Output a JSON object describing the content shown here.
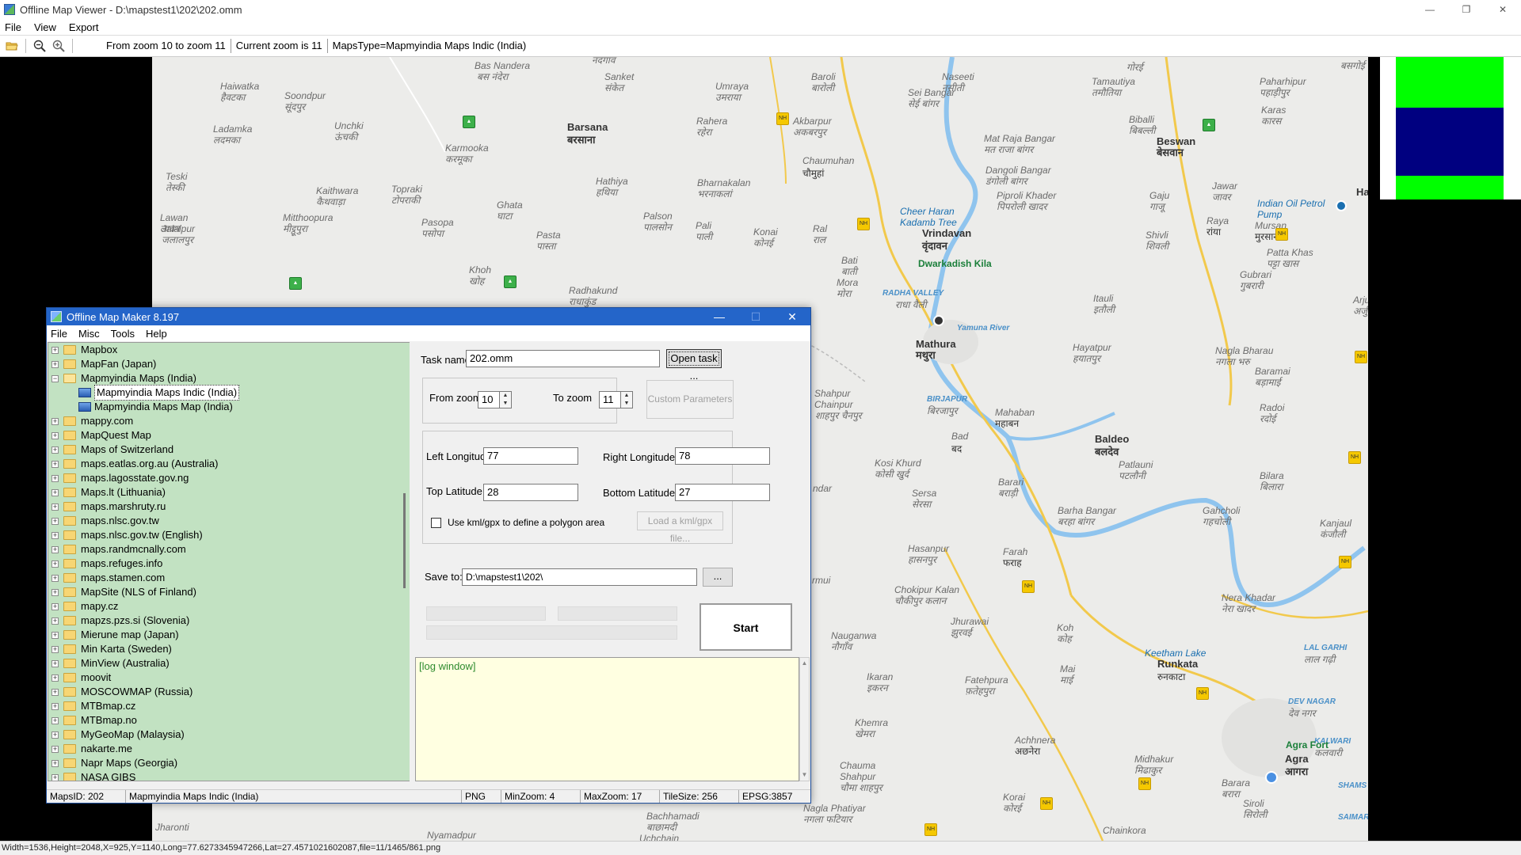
{
  "window": {
    "title": "Offline Map Viewer - D:\\mapstest1\\202\\202.omm",
    "controls": {
      "minimize": "—",
      "restore": "❐",
      "close": "✕"
    }
  },
  "menubar": [
    "File",
    "View",
    "Export"
  ],
  "toolbar": {
    "icons": [
      "open-folder-icon",
      "zoom-out-icon",
      "zoom-in-icon"
    ],
    "zoom_range": "From zoom 10 to zoom 11",
    "current_zoom": "Current zoom is 11",
    "maps_type": "MapsType=Mapmyindia Maps Indic (India)"
  },
  "map": {
    "labels": [
      {
        "text": "Bas Nandera",
        "cls": ""
      },
      {
        "text": "बस नंदेरा",
        "cls": ""
      },
      {
        "text": "नदगाव",
        "cls": ""
      },
      {
        "text": "Sanket",
        "cls": ""
      },
      {
        "text": "संकेत",
        "cls": ""
      },
      {
        "text": "Umraya",
        "cls": ""
      },
      {
        "text": "उमराया",
        "cls": ""
      },
      {
        "text": "Baroli",
        "cls": ""
      },
      {
        "text": "बारोली",
        "cls": ""
      },
      {
        "text": "Naseeti",
        "cls": ""
      },
      {
        "text": "नसीती",
        "cls": ""
      },
      {
        "text": "गोरई",
        "cls": ""
      },
      {
        "text": "बसगोई",
        "cls": ""
      },
      {
        "text": "Haiwatka",
        "cls": ""
      },
      {
        "text": "हैवटका",
        "cls": ""
      },
      {
        "text": "Soondpur",
        "cls": ""
      },
      {
        "text": "सूंदपुर",
        "cls": ""
      },
      {
        "text": "Barsana",
        "cls": "town"
      },
      {
        "text": "बरसाना",
        "cls": "town"
      },
      {
        "text": "Rahera",
        "cls": ""
      },
      {
        "text": "रहेरा",
        "cls": ""
      },
      {
        "text": "Akbarpur",
        "cls": ""
      },
      {
        "text": "अकबरपुर",
        "cls": ""
      },
      {
        "text": "Sei Bangar",
        "cls": ""
      },
      {
        "text": "सेई बांगर",
        "cls": ""
      },
      {
        "text": "Tamautiya",
        "cls": ""
      },
      {
        "text": "तमौतिया",
        "cls": ""
      },
      {
        "text": "Paharhipur",
        "cls": ""
      },
      {
        "text": "पहाड़ीपुर",
        "cls": ""
      },
      {
        "text": "Karas",
        "cls": ""
      },
      {
        "text": "कारस",
        "cls": ""
      },
      {
        "text": "Ladamka",
        "cls": ""
      },
      {
        "text": "लदमका",
        "cls": ""
      },
      {
        "text": "Unchki",
        "cls": ""
      },
      {
        "text": "ऊंचकी",
        "cls": ""
      },
      {
        "text": "Karmooka",
        "cls": ""
      },
      {
        "text": "करमूका",
        "cls": ""
      },
      {
        "text": "Mat Raja Bangar",
        "cls": ""
      },
      {
        "text": "मत राजा बांगर",
        "cls": ""
      },
      {
        "text": "Biballi",
        "cls": ""
      },
      {
        "text": "बिबल्ली",
        "cls": ""
      },
      {
        "text": "Beswan",
        "cls": "town"
      },
      {
        "text": "बेसवान",
        "cls": "town"
      },
      {
        "text": "Chaumuhan",
        "cls": ""
      },
      {
        "text": "चौमुहां",
        "cls": "dark"
      },
      {
        "text": "Dangoli Bangar",
        "cls": ""
      },
      {
        "text": "डंगोली बांगर",
        "cls": ""
      },
      {
        "text": "Teski",
        "cls": ""
      },
      {
        "text": "तेस्की",
        "cls": ""
      },
      {
        "text": "Kaithwara",
        "cls": ""
      },
      {
        "text": "कैथवाड़ा",
        "cls": ""
      },
      {
        "text": "Topraki",
        "cls": ""
      },
      {
        "text": "टोपराकी",
        "cls": ""
      },
      {
        "text": "Hathiya",
        "cls": ""
      },
      {
        "text": "हथिया",
        "cls": ""
      },
      {
        "text": "Bharnakalan",
        "cls": ""
      },
      {
        "text": "भरनाकलां",
        "cls": ""
      },
      {
        "text": "Piproli Khader",
        "cls": ""
      },
      {
        "text": "पिपरोली खादर",
        "cls": ""
      },
      {
        "text": "Gaju",
        "cls": ""
      },
      {
        "text": "गाजू",
        "cls": ""
      },
      {
        "text": "Jawar",
        "cls": ""
      },
      {
        "text": "जावर",
        "cls": ""
      },
      {
        "text": "Ghata",
        "cls": ""
      },
      {
        "text": "घाटा",
        "cls": ""
      },
      {
        "text": "Lawan",
        "cls": ""
      },
      {
        "text": "लावन",
        "cls": ""
      },
      {
        "text": "Mitthoopura",
        "cls": ""
      },
      {
        "text": "मीट्ठूपुरा",
        "cls": ""
      },
      {
        "text": "Pasopa",
        "cls": ""
      },
      {
        "text": "पसोपा",
        "cls": ""
      },
      {
        "text": "Palson",
        "cls": ""
      },
      {
        "text": "पालसोन",
        "cls": ""
      },
      {
        "text": "Cheer Haran",
        "cls": "poi"
      },
      {
        "text": "Kadamb Tree",
        "cls": "poi"
      },
      {
        "text": "Indian Oil Petrol",
        "cls": "poi"
      },
      {
        "text": "Pump",
        "cls": "poi"
      },
      {
        "text": "Pali",
        "cls": ""
      },
      {
        "text": "पाली",
        "cls": ""
      },
      {
        "text": "Vrindavan",
        "cls": "town"
      },
      {
        "text": "वृंदावन",
        "cls": "town"
      },
      {
        "text": "Mursan",
        "cls": ""
      },
      {
        "text": "मुरसान",
        "cls": "dark"
      },
      {
        "text": "Jalalpur",
        "cls": ""
      },
      {
        "text": "जलालपुर",
        "cls": ""
      },
      {
        "text": "Pasta",
        "cls": ""
      },
      {
        "text": "पास्ता",
        "cls": ""
      },
      {
        "text": "Konai",
        "cls": ""
      },
      {
        "text": "कोनई",
        "cls": ""
      },
      {
        "text": "Ral",
        "cls": ""
      },
      {
        "text": "राल",
        "cls": ""
      },
      {
        "text": "Dwarkadish Kila",
        "cls": "green"
      },
      {
        "text": "Shivli",
        "cls": ""
      },
      {
        "text": "शिवली",
        "cls": ""
      },
      {
        "text": "Raya",
        "cls": ""
      },
      {
        "text": "रांया",
        "cls": "dark"
      },
      {
        "text": "Patta Khas",
        "cls": ""
      },
      {
        "text": "पट्टा खास",
        "cls": ""
      },
      {
        "text": "Bati",
        "cls": ""
      },
      {
        "text": "बाती",
        "cls": ""
      },
      {
        "text": "Khoh",
        "cls": ""
      },
      {
        "text": "खोह",
        "cls": ""
      },
      {
        "text": "Gubrari",
        "cls": ""
      },
      {
        "text": "गुबरारी",
        "cls": ""
      },
      {
        "text": "Radhakund",
        "cls": ""
      },
      {
        "text": "राधाकुंड",
        "cls": ""
      },
      {
        "text": "Mora",
        "cls": ""
      },
      {
        "text": "मोरा",
        "cls": ""
      },
      {
        "text": "RADHA VALLEY",
        "cls": "river"
      },
      {
        "text": "राधा वैली",
        "cls": ""
      },
      {
        "text": "Itauli",
        "cls": ""
      },
      {
        "text": "इतौली",
        "cls": ""
      },
      {
        "text": "Arjun",
        "cls": ""
      },
      {
        "text": "अर्जुन",
        "cls": ""
      },
      {
        "text": "Mathura",
        "cls": "town"
      },
      {
        "text": "मथुरा",
        "cls": "town"
      },
      {
        "text": "Yamuna River",
        "cls": "river"
      },
      {
        "text": "Nagla Bharau",
        "cls": ""
      },
      {
        "text": "नगला भरु",
        "cls": ""
      },
      {
        "text": "Hayatpur",
        "cls": ""
      },
      {
        "text": "हयातपुर",
        "cls": ""
      },
      {
        "text": "Baramai",
        "cls": ""
      },
      {
        "text": "बड़ामाई",
        "cls": ""
      },
      {
        "text": "Shahpur",
        "cls": ""
      },
      {
        "text": "Chainpur",
        "cls": ""
      },
      {
        "text": "शाहपुर चैनपुर",
        "cls": ""
      },
      {
        "text": "BIRJAPUR",
        "cls": "river"
      },
      {
        "text": "बिरजापुर",
        "cls": ""
      },
      {
        "text": "Mahaban",
        "cls": ""
      },
      {
        "text": "महाबन",
        "cls": "dark"
      },
      {
        "text": "Radoi",
        "cls": ""
      },
      {
        "text": "रदोई",
        "cls": ""
      },
      {
        "text": "Bad",
        "cls": ""
      },
      {
        "text": "बद",
        "cls": "dark"
      },
      {
        "text": "Baldeo",
        "cls": "town"
      },
      {
        "text": "बलदेव",
        "cls": "town"
      },
      {
        "text": "Kosi Khurd",
        "cls": ""
      },
      {
        "text": "कोसी खुर्द",
        "cls": ""
      },
      {
        "text": "Patlauni",
        "cls": ""
      },
      {
        "text": "पटलौनी",
        "cls": ""
      },
      {
        "text": "Bilara",
        "cls": ""
      },
      {
        "text": "बिलारा",
        "cls": ""
      },
      {
        "text": "Barari",
        "cls": ""
      },
      {
        "text": "बराड़ी",
        "cls": ""
      },
      {
        "text": "ndar",
        "cls": ""
      },
      {
        "text": "Sersa",
        "cls": ""
      },
      {
        "text": "सेरसा",
        "cls": ""
      },
      {
        "text": "Barha Bangar",
        "cls": ""
      },
      {
        "text": "बरहा बांगर",
        "cls": ""
      },
      {
        "text": "Gahcholi",
        "cls": ""
      },
      {
        "text": "गहचोली",
        "cls": ""
      },
      {
        "text": "Kanjaul",
        "cls": ""
      },
      {
        "text": "कंजौली",
        "cls": ""
      },
      {
        "text": "Hasanpur",
        "cls": ""
      },
      {
        "text": "हासनपुर",
        "cls": ""
      },
      {
        "text": "Farah",
        "cls": ""
      },
      {
        "text": "फराह",
        "cls": "dark"
      },
      {
        "text": "rmui",
        "cls": ""
      },
      {
        "text": "Chokipur Kalan",
        "cls": ""
      },
      {
        "text": "चौकीपुर कलान",
        "cls": ""
      },
      {
        "text": "Nera Khadar",
        "cls": ""
      },
      {
        "text": "नेरा खादर",
        "cls": ""
      },
      {
        "text": "Jhurawai",
        "cls": ""
      },
      {
        "text": "झुरवई",
        "cls": ""
      },
      {
        "text": "Koh",
        "cls": ""
      },
      {
        "text": "कोह",
        "cls": ""
      },
      {
        "text": "Nauganwa",
        "cls": ""
      },
      {
        "text": "नौगाँव",
        "cls": ""
      },
      {
        "text": "LAL GARHI",
        "cls": "river"
      },
      {
        "text": "लाल गढ़ी",
        "cls": ""
      },
      {
        "text": "Keetham Lake",
        "cls": "poi"
      },
      {
        "text": "Runkata",
        "cls": "town"
      },
      {
        "text": "रुनकाटा",
        "cls": "dark"
      },
      {
        "text": "Mai",
        "cls": ""
      },
      {
        "text": "माई",
        "cls": ""
      },
      {
        "text": "Fatehpura",
        "cls": ""
      },
      {
        "text": "फ़तेहपुरा",
        "cls": ""
      },
      {
        "text": "Ikaran",
        "cls": ""
      },
      {
        "text": "इकरन",
        "cls": ""
      },
      {
        "text": "DEV NAGAR",
        "cls": "river"
      },
      {
        "text": "देव नगर",
        "cls": ""
      },
      {
        "text": "Khemra",
        "cls": ""
      },
      {
        "text": "खेमरा",
        "cls": ""
      },
      {
        "text": "Achhnera",
        "cls": ""
      },
      {
        "text": "अछनेरा",
        "cls": "dark"
      },
      {
        "text": "KALWARI",
        "cls": "river"
      },
      {
        "text": "कलवारी",
        "cls": ""
      },
      {
        "text": "Agra Fort",
        "cls": "green"
      },
      {
        "text": "Midhakur",
        "cls": ""
      },
      {
        "text": "मिढाकुर",
        "cls": ""
      },
      {
        "text": "Agra",
        "cls": "town"
      },
      {
        "text": "आगरा",
        "cls": "town"
      },
      {
        "text": "Chauma",
        "cls": ""
      },
      {
        "text": "Shahpur",
        "cls": ""
      },
      {
        "text": "चौमा शाहपुर",
        "cls": ""
      },
      {
        "text": "Barara",
        "cls": ""
      },
      {
        "text": "बरारा",
        "cls": ""
      },
      {
        "text": "SHAMS",
        "cls": "river"
      },
      {
        "text": "Korai",
        "cls": ""
      },
      {
        "text": "कोरई",
        "cls": ""
      },
      {
        "text": "Siroli",
        "cls": ""
      },
      {
        "text": "सिरोली",
        "cls": ""
      },
      {
        "text": "SAIMARI",
        "cls": "river"
      },
      {
        "text": "Nagla Phatiyar",
        "cls": ""
      },
      {
        "text": "नगला फटियार",
        "cls": ""
      },
      {
        "text": "Bachhamadi",
        "cls": ""
      },
      {
        "text": "बाछामदी",
        "cls": ""
      },
      {
        "text": "Jharonti",
        "cls": ""
      },
      {
        "text": "Nyamadpur",
        "cls": ""
      },
      {
        "text": "Uchchain",
        "cls": ""
      },
      {
        "text": "Chainkora",
        "cls": ""
      },
      {
        "text": "Ha",
        "cls": "town"
      }
    ]
  },
  "statusbar": "Width=1536,Height=2048,X=925,Y=1140,Long=77.6273345947266,Lat=27.4571021602087,file=11/1465/861.png",
  "dialog": {
    "title": "Offline Map Maker 8.197",
    "controls": {
      "minimize": "—",
      "maximize": "☐",
      "close": "✕"
    },
    "menu": [
      "File",
      "Misc",
      "Tools",
      "Help"
    ],
    "tree": [
      {
        "label": "Mapbox",
        "type": "folder",
        "expander": "+"
      },
      {
        "label": "MapFan (Japan)",
        "type": "folder",
        "expander": "+"
      },
      {
        "label": "Mapmyindia Maps (India)",
        "type": "folder-open",
        "expander": "−"
      },
      {
        "label": "Mapmyindia Maps Indic (India)",
        "type": "map",
        "selected": true
      },
      {
        "label": "Mapmyindia Maps Map (India)",
        "type": "map"
      },
      {
        "label": "mappy.com",
        "type": "folder",
        "expander": "+"
      },
      {
        "label": "MapQuest Map",
        "type": "folder",
        "expander": "+"
      },
      {
        "label": "Maps of Switzerland",
        "type": "folder",
        "expander": "+"
      },
      {
        "label": "maps.eatlas.org.au (Australia)",
        "type": "folder",
        "expander": "+"
      },
      {
        "label": "maps.lagosstate.gov.ng",
        "type": "folder",
        "expander": "+"
      },
      {
        "label": "Maps.lt (Lithuania)",
        "type": "folder",
        "expander": "+"
      },
      {
        "label": "maps.marshruty.ru",
        "type": "folder",
        "expander": "+"
      },
      {
        "label": "maps.nlsc.gov.tw",
        "type": "folder",
        "expander": "+"
      },
      {
        "label": "maps.nlsc.gov.tw (English)",
        "type": "folder",
        "expander": "+"
      },
      {
        "label": "maps.randmcnally.com",
        "type": "folder",
        "expander": "+"
      },
      {
        "label": "maps.refuges.info",
        "type": "folder",
        "expander": "+"
      },
      {
        "label": "maps.stamen.com",
        "type": "folder",
        "expander": "+"
      },
      {
        "label": "MapSite (NLS of Finland)",
        "type": "folder",
        "expander": "+"
      },
      {
        "label": "mapy.cz",
        "type": "folder",
        "expander": "+"
      },
      {
        "label": "mapzs.pzs.si (Slovenia)",
        "type": "folder",
        "expander": "+"
      },
      {
        "label": "Mierune map (Japan)",
        "type": "folder",
        "expander": "+"
      },
      {
        "label": "Min Karta (Sweden)",
        "type": "folder",
        "expander": "+"
      },
      {
        "label": "MinView (Australia)",
        "type": "folder",
        "expander": "+"
      },
      {
        "label": "moovit",
        "type": "folder",
        "expander": "+"
      },
      {
        "label": "MOSCOWMAP (Russia)",
        "type": "folder",
        "expander": "+"
      },
      {
        "label": "MTBmap.cz",
        "type": "folder",
        "expander": "+"
      },
      {
        "label": "MTBmap.no",
        "type": "folder",
        "expander": "+"
      },
      {
        "label": "MyGeoMap (Malaysia)",
        "type": "folder",
        "expander": "+"
      },
      {
        "label": "nakarte.me",
        "type": "folder",
        "expander": "+"
      },
      {
        "label": "Napr Maps (Georgia)",
        "type": "folder",
        "expander": "+"
      },
      {
        "label": "NASA GIBS",
        "type": "folder",
        "expander": "+"
      }
    ],
    "task": {
      "name_label": "Task name",
      "name_value": "202.omm",
      "open_button": "Open task ..."
    },
    "zoom": {
      "from_label": "From zoom",
      "from_value": "10",
      "to_label": "To zoom",
      "to_value": "11",
      "custom_button": "Custom Parameters"
    },
    "bounds": {
      "left_label": "Left Longitude",
      "left_value": "77",
      "right_label": "Right Longitude",
      "right_value": "78",
      "top_label": "Top Latitude",
      "top_value": "28",
      "bottom_label": "Bottom Latitude",
      "bottom_value": "27",
      "kml_label": "Use kml/gpx to define a polygon area",
      "kml_button": "Load a kml/gpx file..."
    },
    "save": {
      "label": "Save to:",
      "value": "D:\\mapstest1\\202\\",
      "browse_button": "..."
    },
    "start_button": "Start",
    "log_text": "[log window]",
    "status": {
      "maps_id": "MapsID: 202",
      "maps_name": "Mapmyindia Maps Indic (India)",
      "format": "PNG",
      "min_zoom": "MinZoom: 4",
      "max_zoom": "MaxZoom: 17",
      "tile_size": "TileSize: 256",
      "epsg": "EPSG:3857"
    }
  },
  "colors": {
    "dialog_title": "#2465c9",
    "tree_bg": "#c2e2c2",
    "log_bg": "#ffffe1",
    "tile_green": "#00ff00",
    "tile_navy": "#000080"
  }
}
